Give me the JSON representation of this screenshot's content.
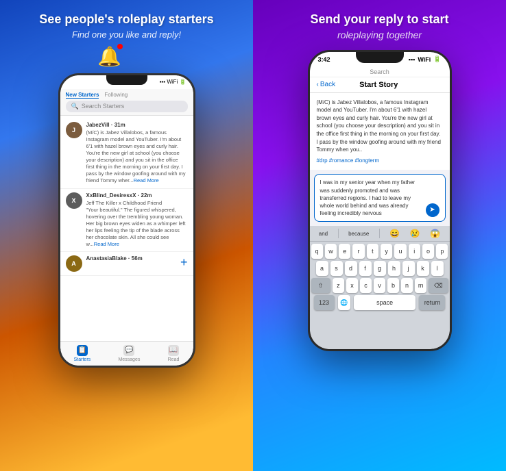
{
  "left": {
    "header": {
      "title": "See people's roleplay starters",
      "subtitle": "Find one you like and reply!"
    },
    "phone": {
      "search_placeholder": "Search Starters",
      "tabs": [
        "New Starters",
        "Following"
      ],
      "active_tab": "New Starters",
      "feed_items": [
        {
          "username": "JabezVill · 31m",
          "avatar_color": "#7b5c3e",
          "avatar_letter": "J",
          "text": "(M/C) is Jabez Villalobos, a famous Instagram model and YouTuber. I'm about 6'1 with hazel brown eyes and curly hair. You're the new girl at school (you choose your description) and you sit in the office first thing in the morning on your first day. I pass by the window goofing around with my friend Tommy wher...",
          "read_more": "Read More"
        },
        {
          "username": "XxBlind_DesiresxX · 22m",
          "avatar_color": "#5c5c5c",
          "avatar_letter": "X",
          "text": "Jeff The Killer x Childhood Friend\n\"Your beautiful.\" The figured whispered, hovering over the trembling young woman. Her big brown eyes widen as a whimper left her lips feeling the tip of the blade across her chocolate skin. All she could see w...",
          "read_more": "Read More"
        },
        {
          "username": "AnastasiaBlake · 56m",
          "avatar_color": "#8b6914",
          "avatar_letter": "A",
          "text": ""
        }
      ],
      "bottom_nav": [
        {
          "label": "Starters",
          "active": true,
          "icon": "📋"
        },
        {
          "label": "Messages",
          "active": false,
          "icon": "💬"
        },
        {
          "label": "Read",
          "active": false,
          "icon": "📖"
        },
        {
          "label": "+",
          "active": false,
          "icon": "+"
        }
      ]
    }
  },
  "right": {
    "header": {
      "title": "Send your reply to start",
      "subtitle": "roleplaying together"
    },
    "phone": {
      "status_time": "3:42",
      "back_label": "Back",
      "search_label": "Search",
      "nav_title": "Start Story",
      "story_text": "(M/C) is Jabez Villalobos, a famous Instagram model and YouTuber. I'm about 6'1 with hazel brown eyes and curly hair. You're the new girl at school (you choose your description) and you sit in the office first thing in the morning on your first day. I pass by the window goofing around with my friend Tommy when you..",
      "story_tags": "#drp #romance #longterm",
      "reply_text": "I was in my senior year when my father was suddenly promoted and was transferred regions. I had to leave my whole world behind and was already feeling incredibly nervous",
      "keyboard_suggestions": [
        "and",
        "because",
        "😄",
        "😢",
        "😱"
      ],
      "keyboard_rows": [
        [
          "q",
          "w",
          "e",
          "r",
          "t",
          "y",
          "u",
          "i",
          "o",
          "p"
        ],
        [
          "a",
          "s",
          "d",
          "f",
          "g",
          "h",
          "j",
          "k",
          "l"
        ],
        [
          "z",
          "x",
          "c",
          "v",
          "b",
          "n",
          "m"
        ],
        [
          "123",
          "space",
          "return"
        ]
      ]
    }
  }
}
